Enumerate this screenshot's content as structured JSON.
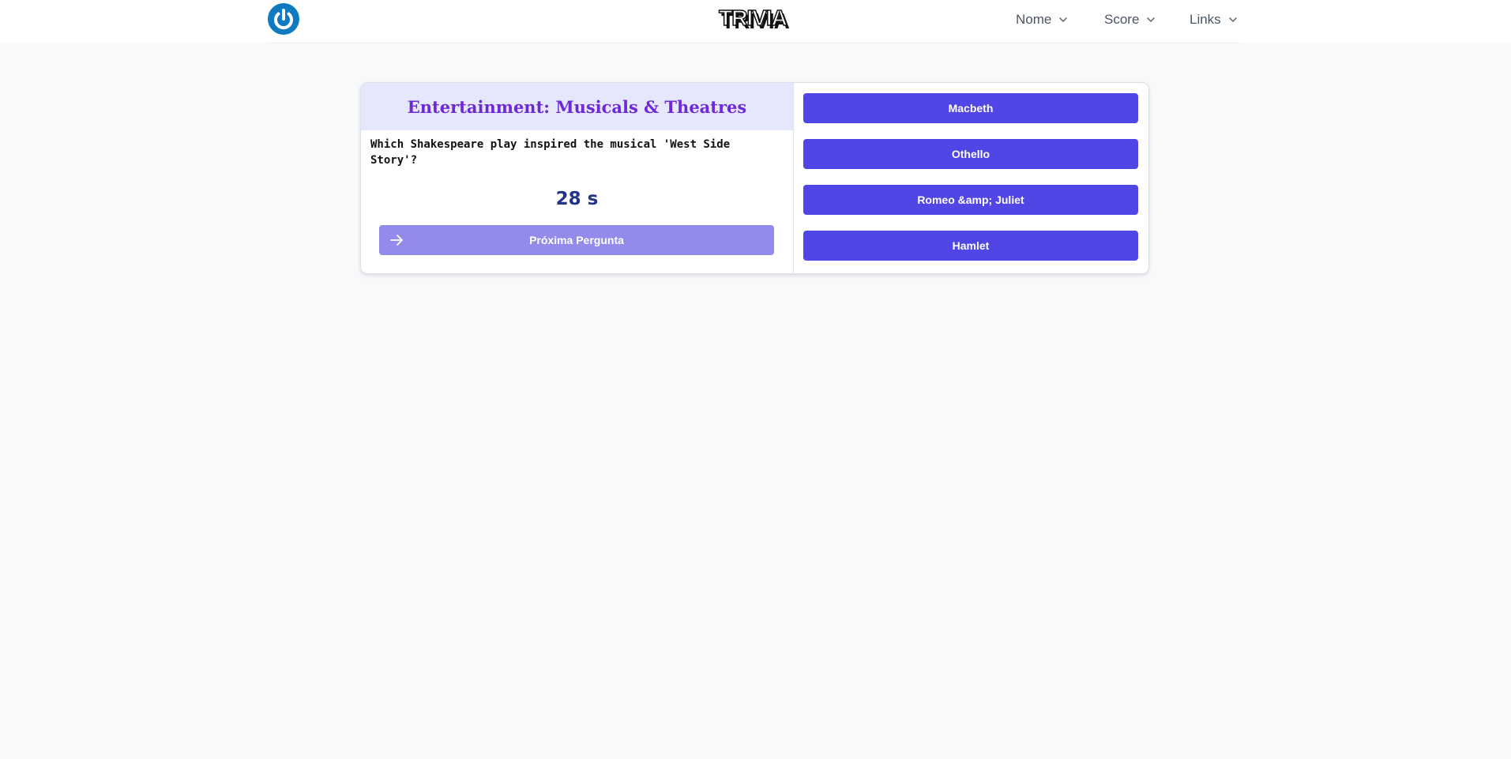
{
  "header": {
    "nav": [
      {
        "label": "Nome"
      },
      {
        "label": "Score"
      },
      {
        "label": "Links"
      }
    ],
    "logo_text": "TRIVIA",
    "icons": {
      "power": "power-icon",
      "chevron": "chevron-down-icon"
    }
  },
  "quiz": {
    "category": "Entertainment: Musicals & Theatres",
    "question": "Which Shakespeare play inspired the musical 'West Side Story'?",
    "timer": "28 s",
    "next_label": "Próxima Pergunta",
    "answers": [
      "Macbeth",
      "Othello",
      "Romeo &amp; Juliet",
      "Hamlet"
    ]
  },
  "colors": {
    "accent": "#4f46e5",
    "next_button": "#938bec",
    "category_text": "#6d28d9",
    "category_bg": "#e5e8fd",
    "timer_text": "#233488",
    "power_icon": "#0e7bc1"
  }
}
